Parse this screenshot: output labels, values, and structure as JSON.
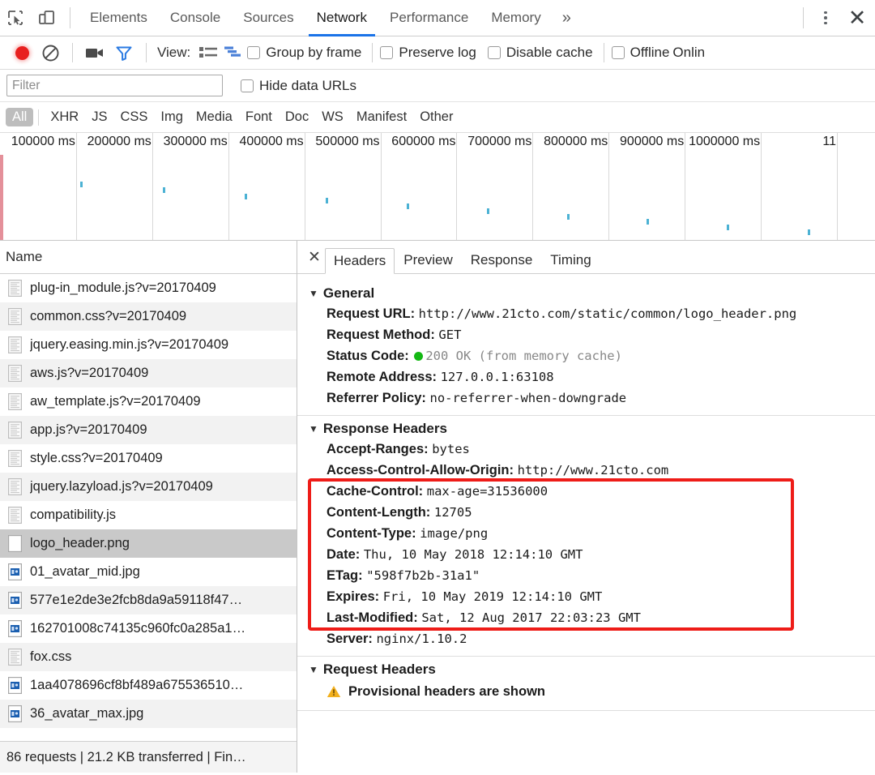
{
  "devtools": {
    "icons": {
      "inspect": "inspect-element-icon",
      "device": "device-toolbar-icon"
    },
    "tabs": [
      {
        "label": "Elements",
        "selected": false
      },
      {
        "label": "Console",
        "selected": false
      },
      {
        "label": "Sources",
        "selected": false
      },
      {
        "label": "Network",
        "selected": true
      },
      {
        "label": "Performance",
        "selected": false
      },
      {
        "label": "Memory",
        "selected": false
      }
    ],
    "more_label": "»",
    "menu_icon": "more-vertical-icon",
    "close_icon": "✕",
    "accent_color": "#1a73e8"
  },
  "toolbar": {
    "record_icon": "record-icon",
    "clear_icon": "clear-icon",
    "camera_icon": "filmstrip-camera-icon",
    "filter_icon": "funnel-filter-icon",
    "view_label": "View:",
    "view_list_icon": "list-view-icon",
    "view_waterfall_icon": "waterfall-view-icon",
    "checkboxes": [
      {
        "label": "Group by frame",
        "checked": false
      },
      {
        "label": "Preserve log",
        "checked": false
      },
      {
        "label": "Disable cache",
        "checked": false
      },
      {
        "label": "Offline",
        "checked": false
      }
    ],
    "throttle_value": "Onlin"
  },
  "filterbar": {
    "placeholder": "Filter",
    "value": "",
    "hide_data_urls": {
      "label": "Hide data URLs",
      "checked": false
    }
  },
  "type_filters": [
    {
      "label": "All",
      "active": true
    },
    {
      "label": "XHR",
      "active": false
    },
    {
      "label": "JS",
      "active": false
    },
    {
      "label": "CSS",
      "active": false
    },
    {
      "label": "Img",
      "active": false
    },
    {
      "label": "Media",
      "active": false
    },
    {
      "label": "Font",
      "active": false
    },
    {
      "label": "Doc",
      "active": false
    },
    {
      "label": "WS",
      "active": false
    },
    {
      "label": "Manifest",
      "active": false
    },
    {
      "label": "Other",
      "active": false
    }
  ],
  "chart_data": {
    "type": "scatter",
    "title": "Network timeline overview",
    "xlabel": "",
    "ylabel": "",
    "xlim": [
      0,
      1150000
    ],
    "grid": true,
    "tick_unit": "ms",
    "tick_labels": [
      "100000 ms",
      "200000 ms",
      "300000 ms",
      "400000 ms",
      "500000 ms",
      "600000 ms",
      "700000 ms",
      "800000 ms",
      "900000 ms",
      "1000000 ms",
      "11"
    ],
    "tick_values": [
      100000,
      200000,
      300000,
      400000,
      500000,
      600000,
      700000,
      800000,
      900000,
      1000000,
      1100000
    ],
    "points": [
      {
        "x": 105000,
        "y": 0.36
      },
      {
        "x": 214000,
        "y": 0.44
      },
      {
        "x": 322000,
        "y": 0.52
      },
      {
        "x": 428000,
        "y": 0.58
      },
      {
        "x": 535000,
        "y": 0.65
      },
      {
        "x": 640000,
        "y": 0.72
      },
      {
        "x": 745000,
        "y": 0.79
      },
      {
        "x": 850000,
        "y": 0.86
      },
      {
        "x": 955000,
        "y": 0.93
      },
      {
        "x": 1062000,
        "y": 1.0
      }
    ],
    "point_color": "#4cb2d4",
    "load_band_color": "#e4909a"
  },
  "requests": {
    "column_header": "Name",
    "rows": [
      {
        "name": "plug-in_module.js?v=20170409",
        "icon": "script-file-icon"
      },
      {
        "name": "common.css?v=20170409",
        "icon": "script-file-icon"
      },
      {
        "name": "jquery.easing.min.js?v=20170409",
        "icon": "script-file-icon"
      },
      {
        "name": "aws.js?v=20170409",
        "icon": "script-file-icon"
      },
      {
        "name": "aw_template.js?v=20170409",
        "icon": "script-file-icon"
      },
      {
        "name": "app.js?v=20170409",
        "icon": "script-file-icon"
      },
      {
        "name": "style.css?v=20170409",
        "icon": "script-file-icon"
      },
      {
        "name": "jquery.lazyload.js?v=20170409",
        "icon": "script-file-icon"
      },
      {
        "name": "compatibility.js",
        "icon": "script-file-icon"
      },
      {
        "name": "logo_header.png",
        "icon": "blank-file-icon",
        "selected": true
      },
      {
        "name": "01_avatar_mid.jpg",
        "icon": "image-file-icon"
      },
      {
        "name": "577e1e2de3e2fcb8da9a59118f47…",
        "icon": "image-file-icon"
      },
      {
        "name": "162701008c74135c960fc0a285a1…",
        "icon": "image-file-icon"
      },
      {
        "name": "fox.css",
        "icon": "script-file-icon"
      },
      {
        "name": "1aa4078696cf8bf489a675536510…",
        "icon": "image-file-icon"
      },
      {
        "name": "36_avatar_max.jpg",
        "icon": "image-file-icon"
      }
    ],
    "summary": "86 requests | 21.2 KB transferred | Fin…"
  },
  "detail": {
    "close_icon": "✕",
    "tabs": [
      {
        "label": "Headers",
        "selected": true
      },
      {
        "label": "Preview",
        "selected": false
      },
      {
        "label": "Response",
        "selected": false
      },
      {
        "label": "Timing",
        "selected": false
      }
    ],
    "sections": [
      {
        "title": "General",
        "expanded": true,
        "lines": [
          {
            "key": "Request URL:",
            "value": "http://www.21cto.com/static/common/logo_header.png"
          },
          {
            "key": "Request Method:",
            "value": "GET"
          },
          {
            "key": "Status Code:",
            "value": "200 OK (from memory cache)",
            "status_dot": "#14b814",
            "muted": true
          },
          {
            "key": "Remote Address:",
            "value": "127.0.0.1:63108"
          },
          {
            "key": "Referrer Policy:",
            "value": "no-referrer-when-downgrade"
          }
        ]
      },
      {
        "title": "Response Headers",
        "expanded": true,
        "lines": [
          {
            "key": "Accept-Ranges:",
            "value": "bytes"
          },
          {
            "key": "Access-Control-Allow-Origin:",
            "value": "http://www.21cto.com"
          },
          {
            "key": "Cache-Control:",
            "value": "max-age=31536000"
          },
          {
            "key": "Content-Length:",
            "value": "12705"
          },
          {
            "key": "Content-Type:",
            "value": "image/png"
          },
          {
            "key": "Date:",
            "value": "Thu, 10 May 2018 12:14:10 GMT"
          },
          {
            "key": "ETag:",
            "value": "\"598f7b2b-31a1\""
          },
          {
            "key": "Expires:",
            "value": "Fri, 10 May 2019 12:14:10 GMT"
          },
          {
            "key": "Last-Modified:",
            "value": "Sat, 12 Aug 2017 22:03:23 GMT"
          },
          {
            "key": "Server:",
            "value": "nginx/1.10.2"
          }
        ]
      },
      {
        "title": "Request Headers",
        "expanded": true,
        "warning": "Provisional headers are shown",
        "warning_icon": "warning-triangle-icon",
        "lines": []
      }
    ],
    "highlight_color": "#ee1c18"
  }
}
